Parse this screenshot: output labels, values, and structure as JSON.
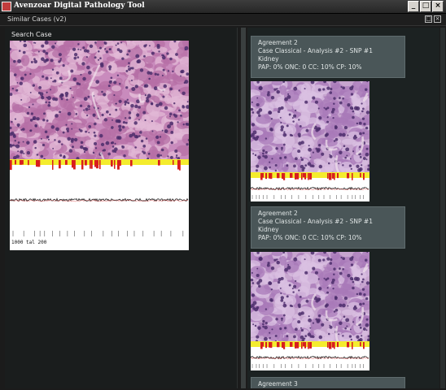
{
  "window": {
    "title": "Avenzoar Digital Pathology Tool",
    "buttons": {
      "minimize": "_",
      "maximize": "□",
      "close": "×"
    }
  },
  "subwindow": {
    "title": "Similar Cases (v2)",
    "buttons": {
      "restore": "□",
      "close": "×"
    }
  },
  "search_panel": {
    "label": "Search Case",
    "axis_caption": "1000 tal 200"
  },
  "similar_cases": [
    {
      "line1": "Agreement 2",
      "line2": "Case Classical - Analysis #2 - SNP #1",
      "line3": "Kidney",
      "line4": "PAP: 0% ONC: 0 CC: 10% CP: 10%"
    },
    {
      "line1": "Agreement 2",
      "line2": "Case Classical - Analysis #2 - SNP #1",
      "line3": "Kidney",
      "line4": "PAP: 0% ONC: 0 CC: 10% CP: 10%"
    },
    {
      "line1": "Agreement 3"
    }
  ],
  "colors": {
    "tissue_pink": "#c98bbd",
    "nucleus_purple": "#4b2d6b",
    "track_yellow": "#f4ec2e",
    "track_red": "#d81e1e",
    "card_bg": "#4a5658"
  }
}
